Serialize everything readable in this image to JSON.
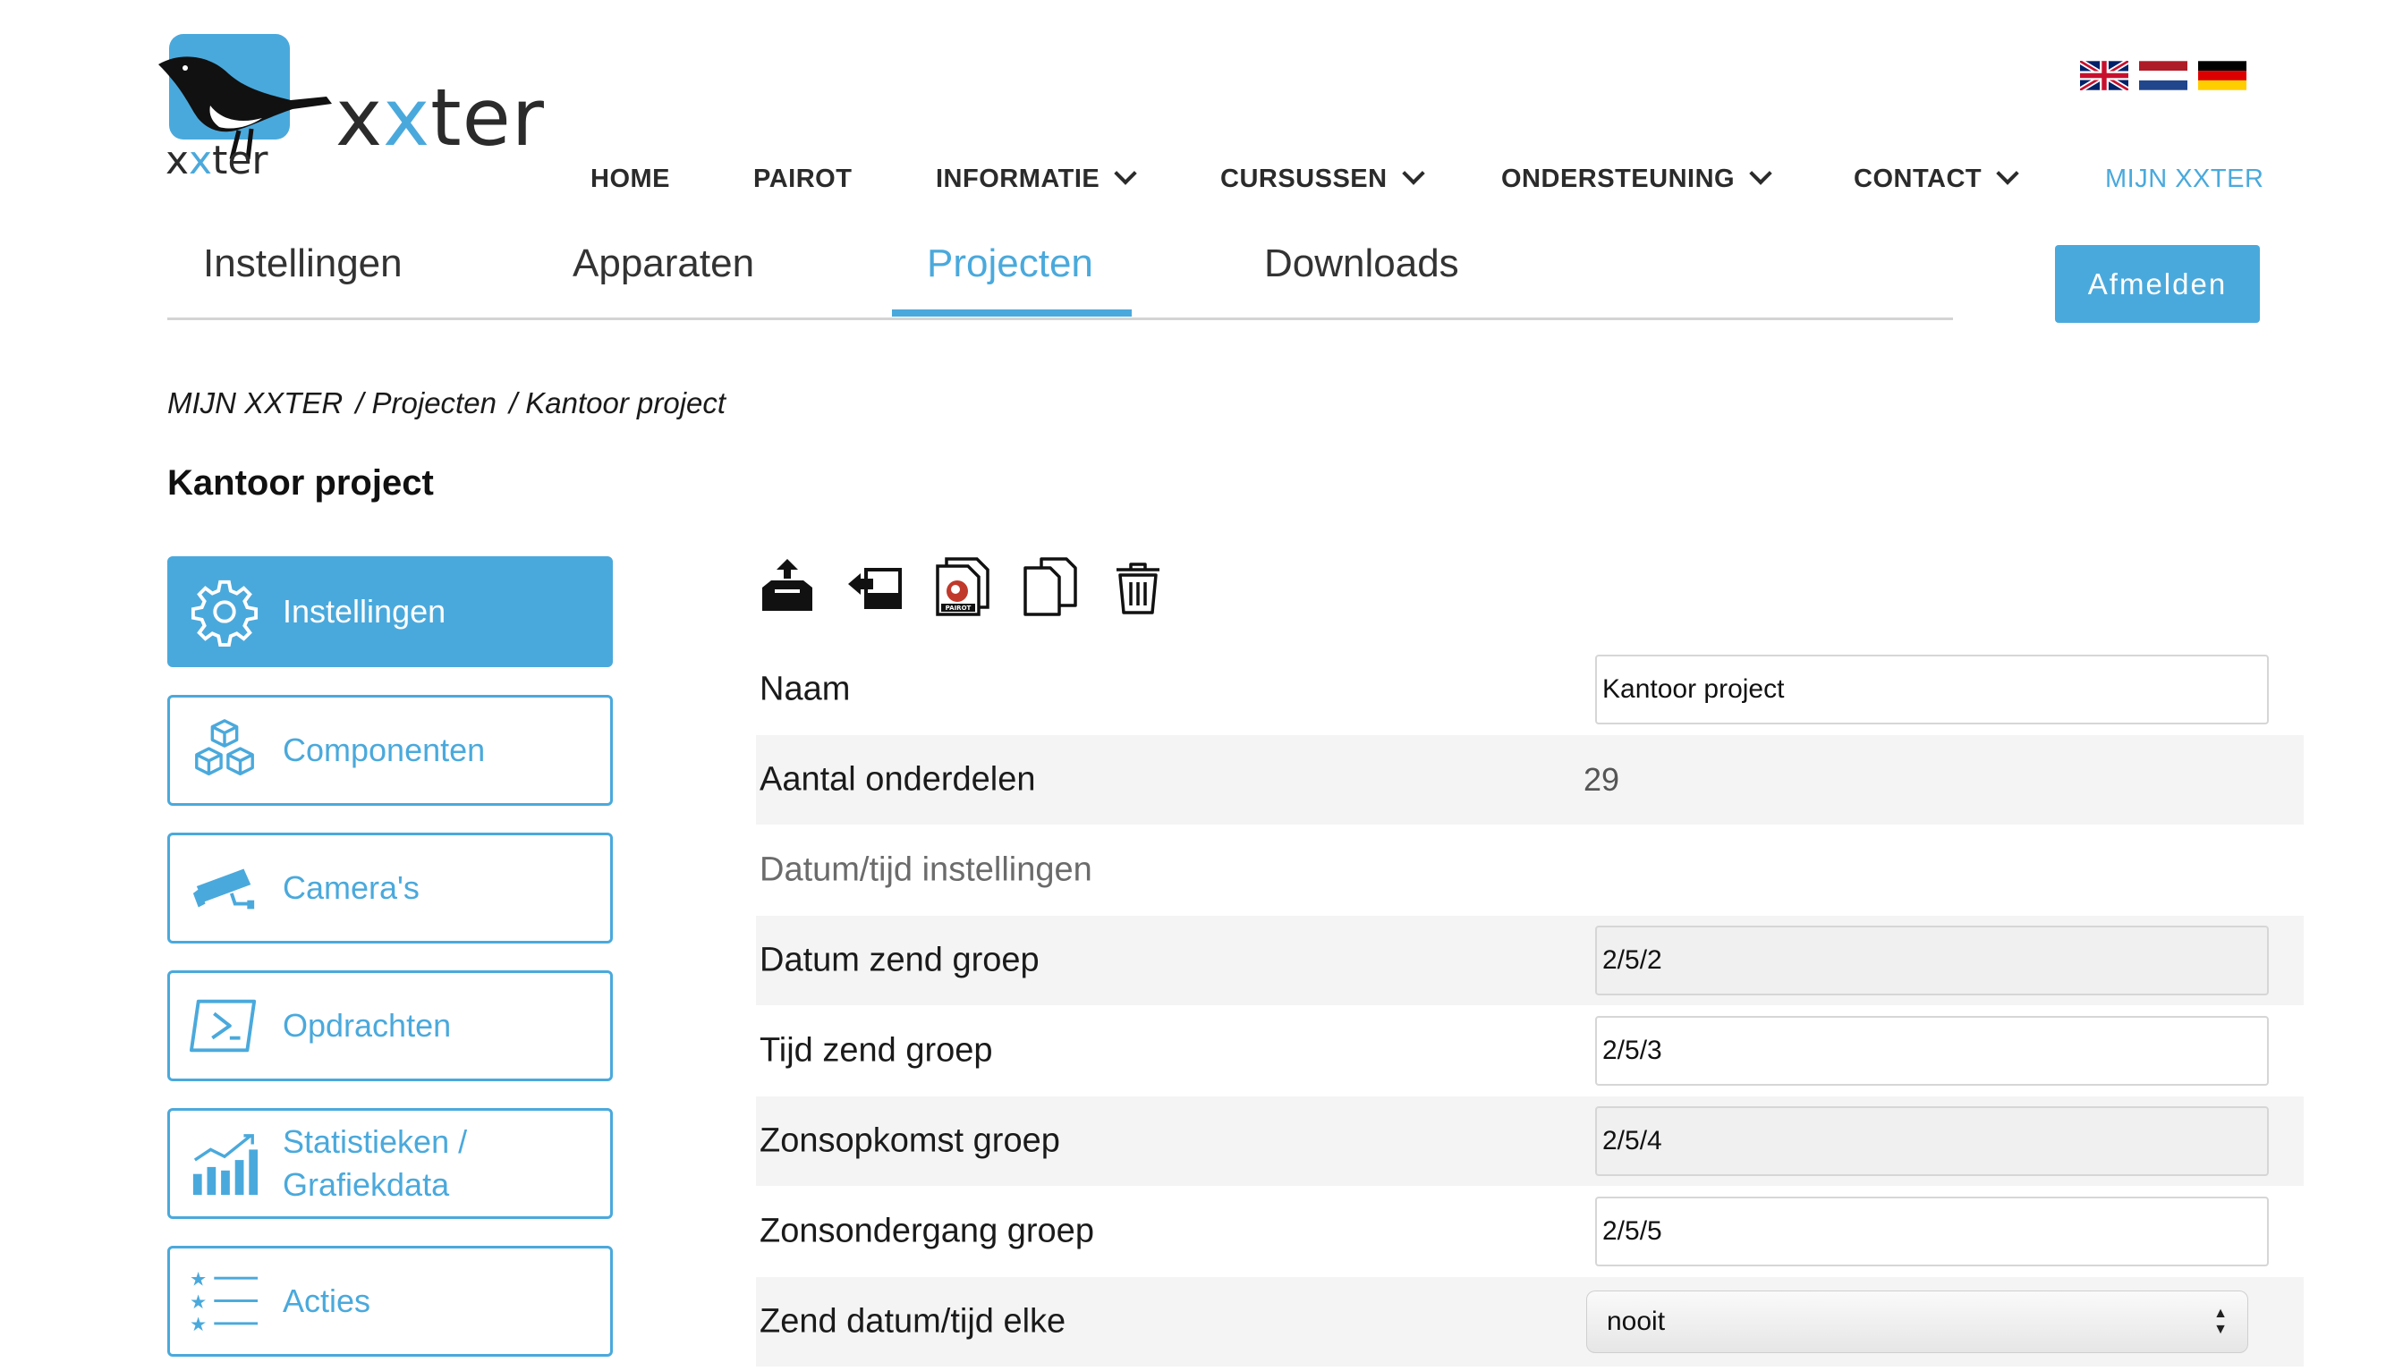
{
  "logo": {
    "word_main_prefix": "x",
    "word_main_x": "x",
    "word_main_suffix": "ter",
    "word_small_prefix": "x",
    "word_small_x": "x",
    "word_small_suffix": "ter"
  },
  "flags": [
    "uk-flag-icon",
    "netherlands-flag-icon",
    "germany-flag-icon"
  ],
  "nav": {
    "home": "HOME",
    "pairot": "PAIROT",
    "informatie": "INFORMATIE",
    "cursussen": "CURSUSSEN",
    "ondersteuning": "ONDERSTEUNING",
    "contact": "CONTACT",
    "mijn": "MIJN XXTER"
  },
  "tabs": {
    "instellingen": "Instellingen",
    "apparaten": "Apparaten",
    "projecten": "Projecten",
    "downloads": "Downloads",
    "active": "Projecten"
  },
  "logout_label": "Afmelden",
  "breadcrumb": [
    "MIJN XXTER",
    "/ Projecten",
    "/ Kantoor project"
  ],
  "page_title": "Kantoor project",
  "sidebar": [
    {
      "label": "Instellingen",
      "icon": "gear-icon",
      "active": true
    },
    {
      "label": "Componenten",
      "icon": "cubes-icon",
      "active": false
    },
    {
      "label": "Camera's",
      "icon": "camera-icon",
      "active": false
    },
    {
      "label": "Opdrachten",
      "icon": "terminal-icon",
      "active": false
    },
    {
      "label_line1": "Statistieken /",
      "label_line2": "Grafiekdata",
      "icon": "bar-chart-icon",
      "active": false
    },
    {
      "label": "Acties",
      "icon": "star-list-icon",
      "active": false
    }
  ],
  "toolbar": [
    "upload-icon",
    "import-icon",
    "pairot-document-icon",
    "copy-icon",
    "trash-icon"
  ],
  "toolbar_badge": "PAIROT",
  "form": {
    "naam_label": "Naam",
    "naam_value": "Kantoor project",
    "aantal_label": "Aantal onderdelen",
    "aantal_value": "29",
    "section_label": "Datum/tijd instellingen",
    "datum_label": "Datum zend groep",
    "datum_value": "2/5/2",
    "tijd_label": "Tijd zend groep",
    "tijd_value": "2/5/3",
    "zonsopkomst_label": "Zonsopkomst groep",
    "zonsopkomst_value": "2/5/4",
    "zonsondergang_label": "Zonsondergang groep",
    "zonsondergang_value": "2/5/5",
    "zend_label": "Zend datum/tijd elke",
    "zend_value": "nooit"
  },
  "colors": {
    "accent": "#4aa9dc",
    "row_shade": "#f4f4f4",
    "text": "#1a1a1a"
  }
}
